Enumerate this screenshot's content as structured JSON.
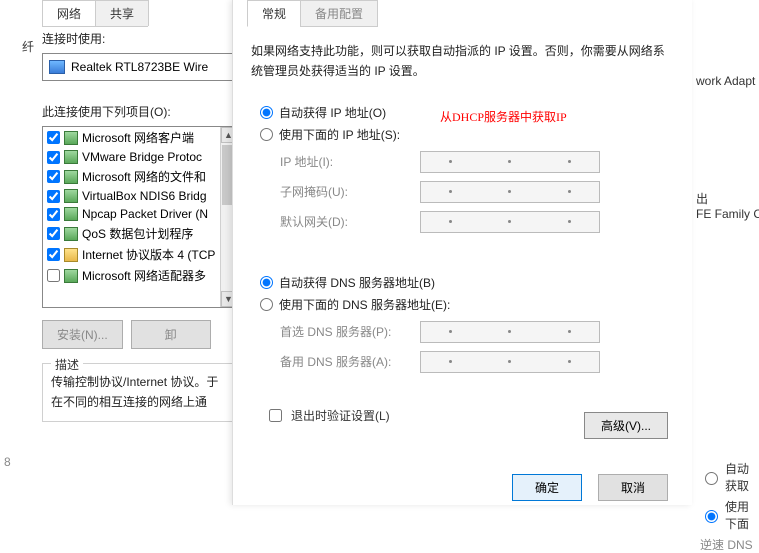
{
  "left": {
    "tabs": [
      "网络",
      "共享"
    ],
    "connect_label": "连接时使用:",
    "adapter": "Realtek RTL8723BE Wire",
    "items_label": "此连接使用下列项目(O):",
    "items": [
      {
        "checked": true,
        "label": "Microsoft 网络客户端"
      },
      {
        "checked": true,
        "label": "VMware Bridge Protoc"
      },
      {
        "checked": true,
        "label": "Microsoft 网络的文件和"
      },
      {
        "checked": true,
        "label": "VirtualBox NDIS6 Bridg"
      },
      {
        "checked": true,
        "label": "Npcap Packet Driver (N"
      },
      {
        "checked": true,
        "label": "QoS 数据包计划程序"
      },
      {
        "checked": true,
        "label": "Internet 协议版本 4 (TCP"
      },
      {
        "checked": false,
        "label": "Microsoft 网络适配器多"
      }
    ],
    "install_btn": "安装(N)...",
    "uninstall_btn": "卸",
    "desc_title": "描述",
    "desc_text": "传输控制协议/Internet 协议。于在不同的相互连接的网络上通"
  },
  "right": {
    "tabs": [
      "常规",
      "备用配置"
    ],
    "intro": "如果网络支持此功能，则可以获取自动指派的 IP 设置。否则，你需要从网络系统管理员处获得适当的 IP 设置。",
    "annotation": "从DHCP服务器中获取IP",
    "ip_auto": "自动获得 IP 地址(O)",
    "ip_manual": "使用下面的 IP 地址(S):",
    "ip_addr": "IP 地址(I):",
    "subnet": "子网掩码(U):",
    "gateway": "默认网关(D):",
    "dns_auto": "自动获得 DNS 服务器地址(B)",
    "dns_manual": "使用下面的 DNS 服务器地址(E):",
    "dns_pref": "首选 DNS 服务器(P):",
    "dns_alt": "备用 DNS 服务器(A):",
    "exit_validate": "退出时验证设置(L)",
    "advanced": "高级(V)...",
    "ok": "确定",
    "cancel": "取消"
  },
  "bg": {
    "adapter_text": "work Adapt",
    "family_text": "出\nFE Family C",
    "num": "8",
    "ch": "纤",
    "r1": "自动获取",
    "r2": "使用下面",
    "r3": "逆速 DNS"
  }
}
